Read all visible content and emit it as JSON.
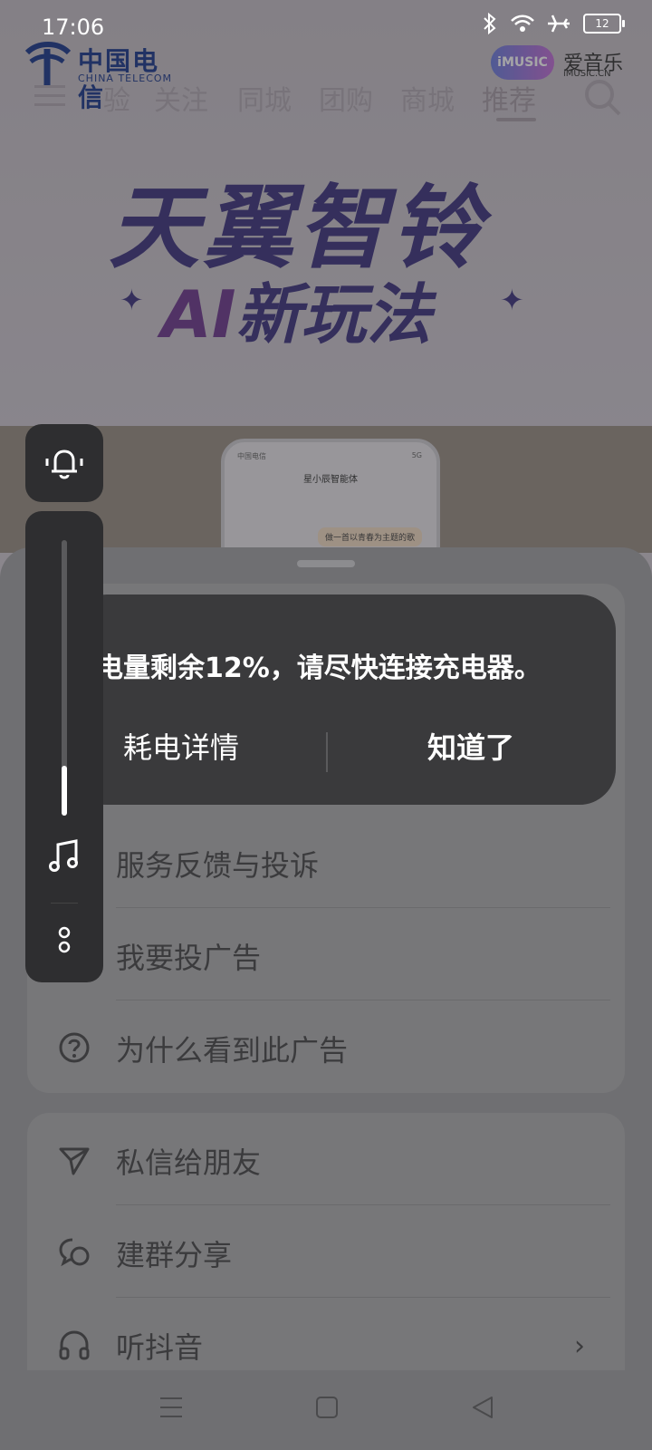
{
  "status_bar": {
    "time": "17:06",
    "battery_level": "12"
  },
  "brand": {
    "carrier_name": "中国电信",
    "carrier_en": "CHINA TELECOM",
    "music_badge": "iMUSIC",
    "music_cn": "爱音乐",
    "music_url": "iMUSIC.CN"
  },
  "top_nav": {
    "tabs": [
      "验",
      "关注",
      "同城",
      "团购",
      "商城",
      "推荐"
    ],
    "active": "推荐"
  },
  "banner": {
    "title": "天翼智铃",
    "subtitle_ai": "AI",
    "subtitle_rest": "新玩法"
  },
  "promo_phone": {
    "carrier": "中国电信",
    "signal": "5G",
    "title": "星小辰智能体",
    "message": "做一首以青春为主题的歌"
  },
  "toast": {
    "message": "电量剩余12%，请尽快连接充电器。",
    "left_button": "耗电详情",
    "right_button": "知道了"
  },
  "volume": {
    "level": 0.18
  },
  "menu": {
    "group1": [
      {
        "label": "服务反馈与投诉",
        "icon": "feedback-icon"
      },
      {
        "label": "我要投广告",
        "icon": "camera-icon"
      },
      {
        "label": "为什么看到此广告",
        "icon": "question-icon"
      }
    ],
    "group2": [
      {
        "label": "私信给朋友",
        "icon": "send-icon"
      },
      {
        "label": "建群分享",
        "icon": "group-chat-icon"
      },
      {
        "label": "听抖音",
        "icon": "headphones-icon"
      }
    ]
  },
  "colors": {
    "toast_bg": "#3a3a3c",
    "battery_warning": "#ffd23a",
    "banner_text": "#3e3480"
  }
}
